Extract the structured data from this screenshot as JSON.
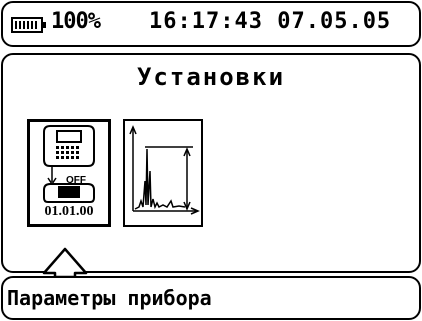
{
  "status": {
    "battery_text": "100%",
    "time": "16:17:43",
    "date": "07.05.05"
  },
  "main": {
    "title": "Установки",
    "tiles": [
      {
        "name": "device-settings",
        "icon": "device-clock-icon",
        "off_label": "OFF",
        "date_label": "01.01.00"
      },
      {
        "name": "spectrum-settings",
        "icon": "spectrum-chart-icon"
      }
    ]
  },
  "bottom": {
    "label": "Параметры прибора"
  }
}
